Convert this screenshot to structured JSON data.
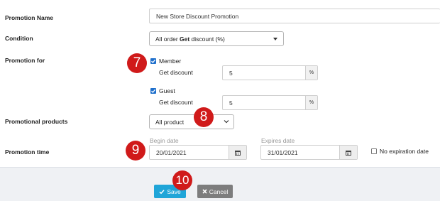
{
  "form": {
    "promotion_name": {
      "label": "Promotion Name",
      "value": "New Store Discount Promotion"
    },
    "condition": {
      "label": "Condition",
      "value_prefix": "All order ",
      "value_bold": "Get",
      "value_suffix": " discount (%)"
    },
    "promotion_for": {
      "label": "Promotion for",
      "member": {
        "label": "Member",
        "checked": true,
        "discount_label": "Get discount",
        "discount_value": "5",
        "unit": "%"
      },
      "guest": {
        "label": "Guest",
        "checked": true,
        "discount_label": "Get discount",
        "discount_value": "5",
        "unit": "%"
      }
    },
    "promotional_products": {
      "label": "Promotional products",
      "value": "All product"
    },
    "promotion_time": {
      "label": "Promotion time",
      "begin_label": "Begin date",
      "begin_value": "20/01/2021",
      "expires_label": "Expires date",
      "expires_value": "31/01/2021",
      "no_expiration_label": "No expiration date",
      "no_expiration_checked": false
    }
  },
  "footer": {
    "save_label": "Save",
    "cancel_label": "Cancel"
  },
  "badges": {
    "b7": "7",
    "b8": "8",
    "b9": "9",
    "b10": "10"
  },
  "icons": {
    "calendar": "calendar-icon",
    "check": "check-icon",
    "close": "close-icon",
    "caret": "caret-down-icon",
    "chevron": "chevron-down-icon"
  },
  "colors": {
    "badge": "#d01a1a",
    "save": "#1fa5d8",
    "cancel": "#7d7d7d",
    "checkbox": "#1e6fcc",
    "footer_bg": "#eff1f4"
  }
}
